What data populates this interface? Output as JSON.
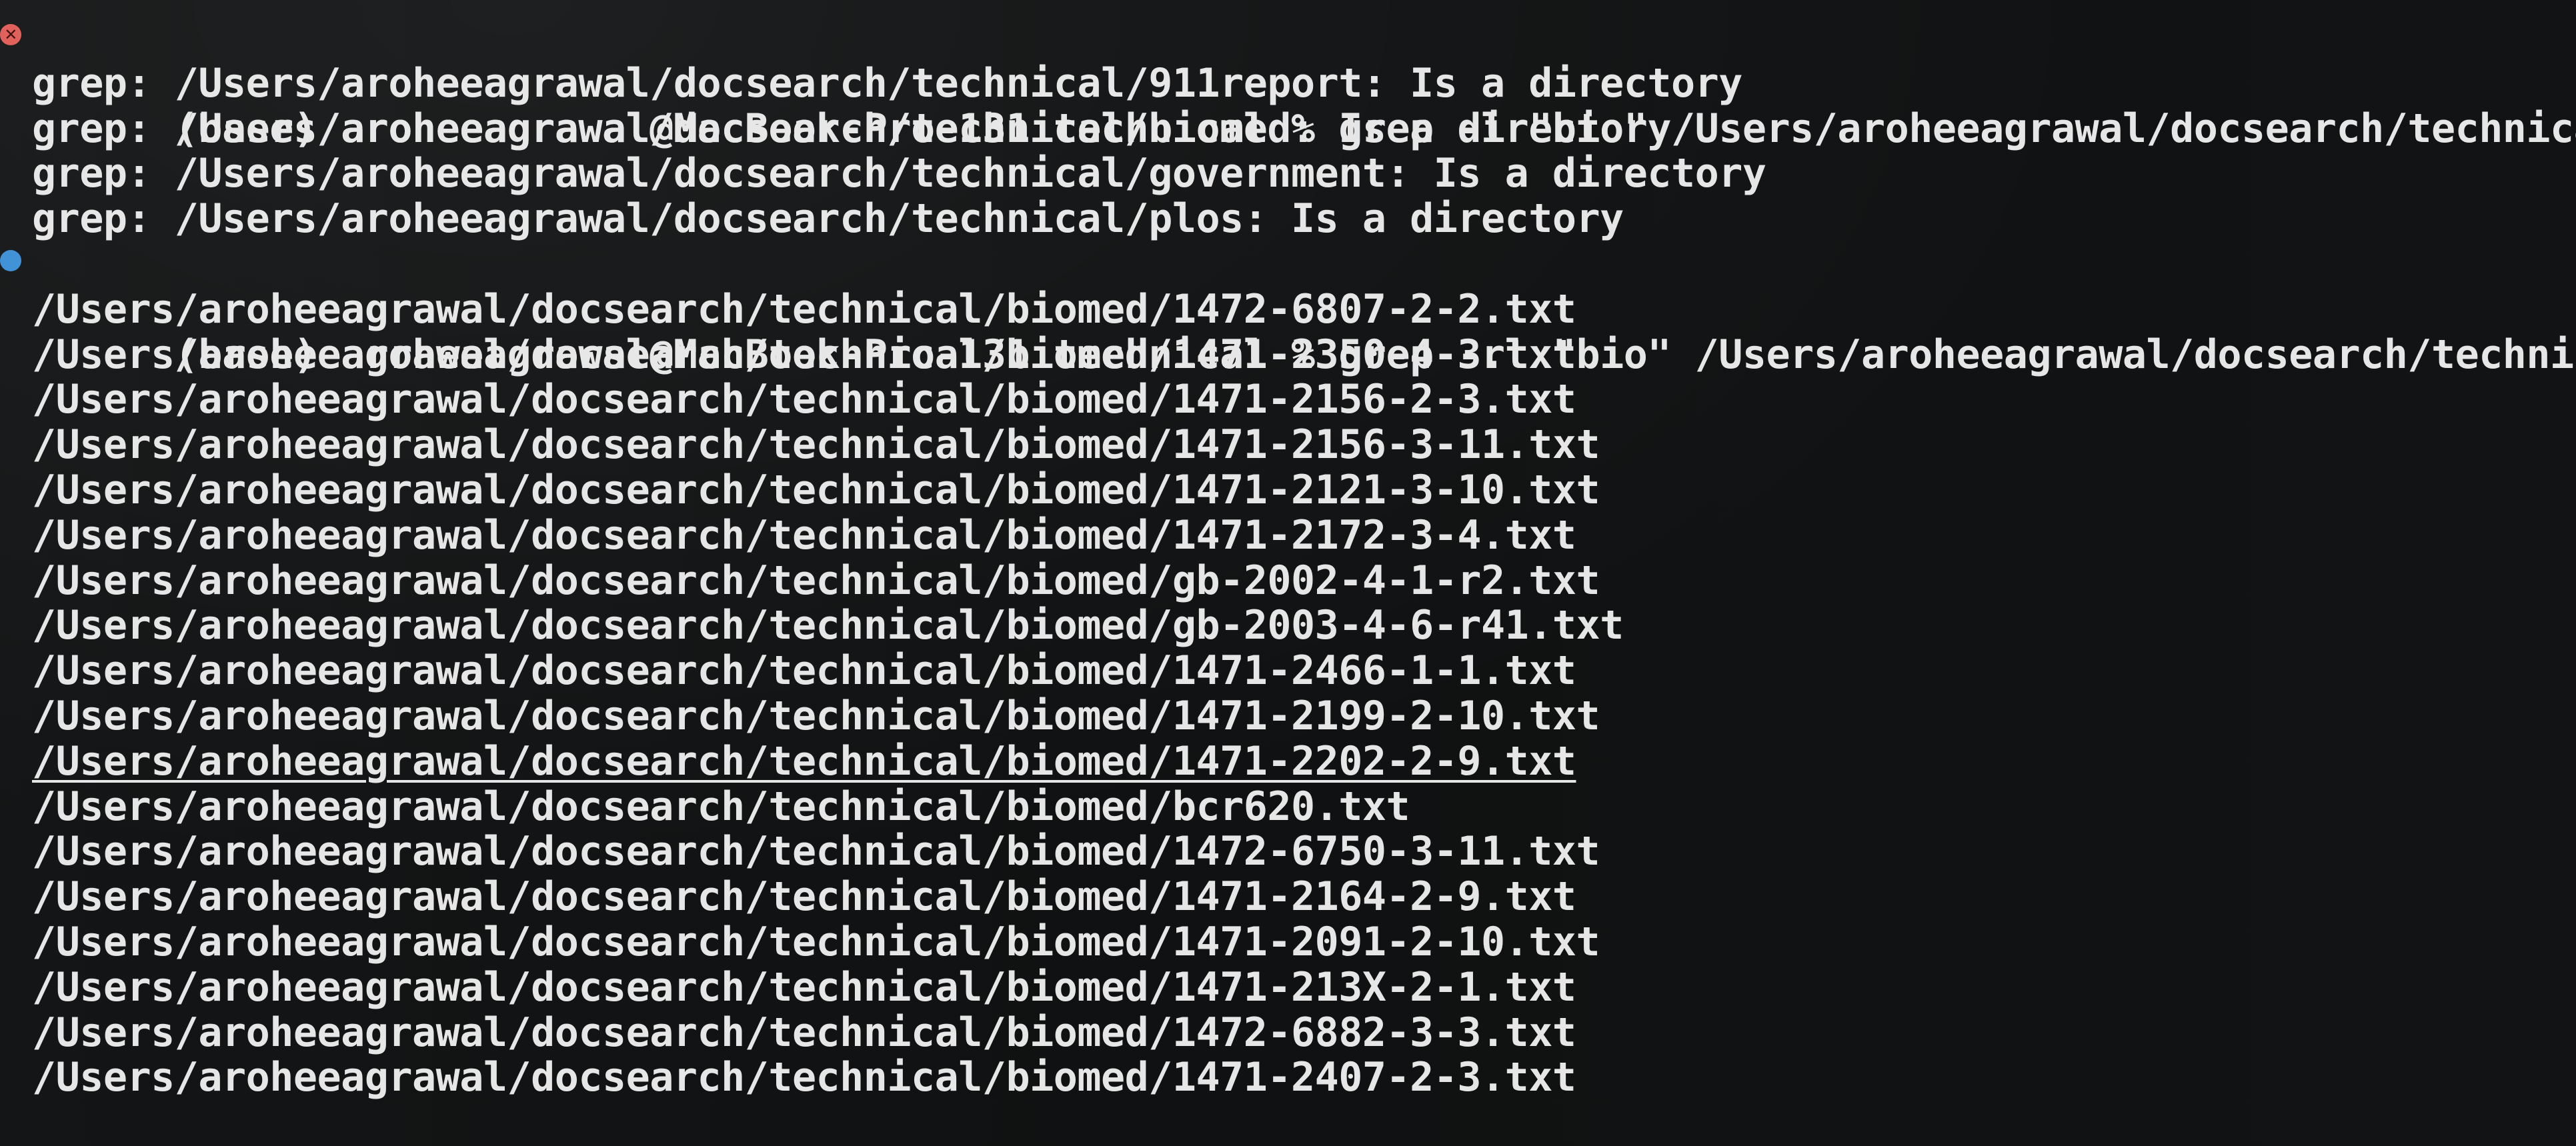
{
  "colors": {
    "background": "#0f1112",
    "text": "#e6e6e6",
    "error_marker": "#e05b55",
    "success_marker": "#3b8fd6"
  },
  "icons": {
    "error_marker": "x-circle-icon",
    "success_marker": "dot-icon"
  },
  "terminal": {
    "commands": [
      {
        "prompt": "(base) aroheeagrawal@MacBook-Pro-131 technical % ",
        "command": "grep -l \"bio\" /Users/aroheeagrawal/docsearch/technical/*",
        "status_icon": "x-circle-icon",
        "output": [
          "grep: /Users/aroheeagrawal/docsearch/technical/911report: Is a directory",
          "grep: /Users/aroheeagrawal/docsearch/technical/biomed: Is a directory",
          "grep: /Users/aroheeagrawal/docsearch/technical/government: Is a directory",
          "grep: /Users/aroheeagrawal/docsearch/technical/plos: Is a directory"
        ]
      },
      {
        "prompt": "(base) aroheeagrawal@MacBook-Pro-131 technical % ",
        "command": "grep -rl \"bio\" /Users/aroheeagrawal/docsearch/technical/biomed",
        "status_icon": "dot-icon",
        "output": [
          "/Users/aroheeagrawal/docsearch/technical/biomed/1472-6807-2-2.txt",
          "/Users/aroheeagrawal/docsearch/technical/biomed/1471-2350-4-3.txt",
          "/Users/aroheeagrawal/docsearch/technical/biomed/1471-2156-2-3.txt",
          "/Users/aroheeagrawal/docsearch/technical/biomed/1471-2156-3-11.txt",
          "/Users/aroheeagrawal/docsearch/technical/biomed/1471-2121-3-10.txt",
          "/Users/aroheeagrawal/docsearch/technical/biomed/1471-2172-3-4.txt",
          "/Users/aroheeagrawal/docsearch/technical/biomed/gb-2002-4-1-r2.txt",
          "/Users/aroheeagrawal/docsearch/technical/biomed/gb-2003-4-6-r41.txt",
          "/Users/aroheeagrawal/docsearch/technical/biomed/1471-2466-1-1.txt",
          "/Users/aroheeagrawal/docsearch/technical/biomed/1471-2199-2-10.txt",
          "/Users/aroheeagrawal/docsearch/technical/biomed/1471-2202-2-9.txt",
          "/Users/aroheeagrawal/docsearch/technical/biomed/bcr620.txt",
          "/Users/aroheeagrawal/docsearch/technical/biomed/1472-6750-3-11.txt",
          "/Users/aroheeagrawal/docsearch/technical/biomed/1471-2164-2-9.txt",
          "/Users/aroheeagrawal/docsearch/technical/biomed/1471-2091-2-10.txt",
          "/Users/aroheeagrawal/docsearch/technical/biomed/1471-213X-2-1.txt",
          "/Users/aroheeagrawal/docsearch/technical/biomed/1472-6882-3-3.txt",
          "/Users/aroheeagrawal/docsearch/technical/biomed/1471-2407-2-3.txt"
        ]
      }
    ]
  }
}
